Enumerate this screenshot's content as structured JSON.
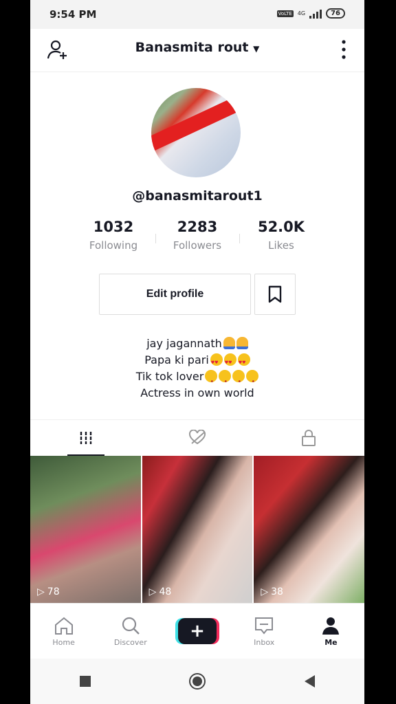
{
  "status_bar": {
    "time": "9:54 PM",
    "network": "4G",
    "battery": "76"
  },
  "header": {
    "title": "Banasmita rout"
  },
  "profile": {
    "handle": "@banasmitarout1",
    "stats": [
      {
        "value": "1032",
        "label": "Following"
      },
      {
        "value": "2283",
        "label": "Followers"
      },
      {
        "value": "52.0K",
        "label": "Likes"
      }
    ],
    "edit_label": "Edit profile",
    "bio": [
      "jay jagannath",
      "Papa ki pari",
      "Tik tok lover",
      "Actress in own world"
    ]
  },
  "videos": [
    {
      "views": "78"
    },
    {
      "views": "48"
    },
    {
      "views": "38"
    }
  ],
  "bottom_nav": [
    {
      "label": "Home",
      "icon": "home-icon"
    },
    {
      "label": "Discover",
      "icon": "search-icon"
    },
    {
      "label": "",
      "icon": "plus-icon"
    },
    {
      "label": "Inbox",
      "icon": "inbox-icon"
    },
    {
      "label": "Me",
      "icon": "profile-icon"
    }
  ]
}
